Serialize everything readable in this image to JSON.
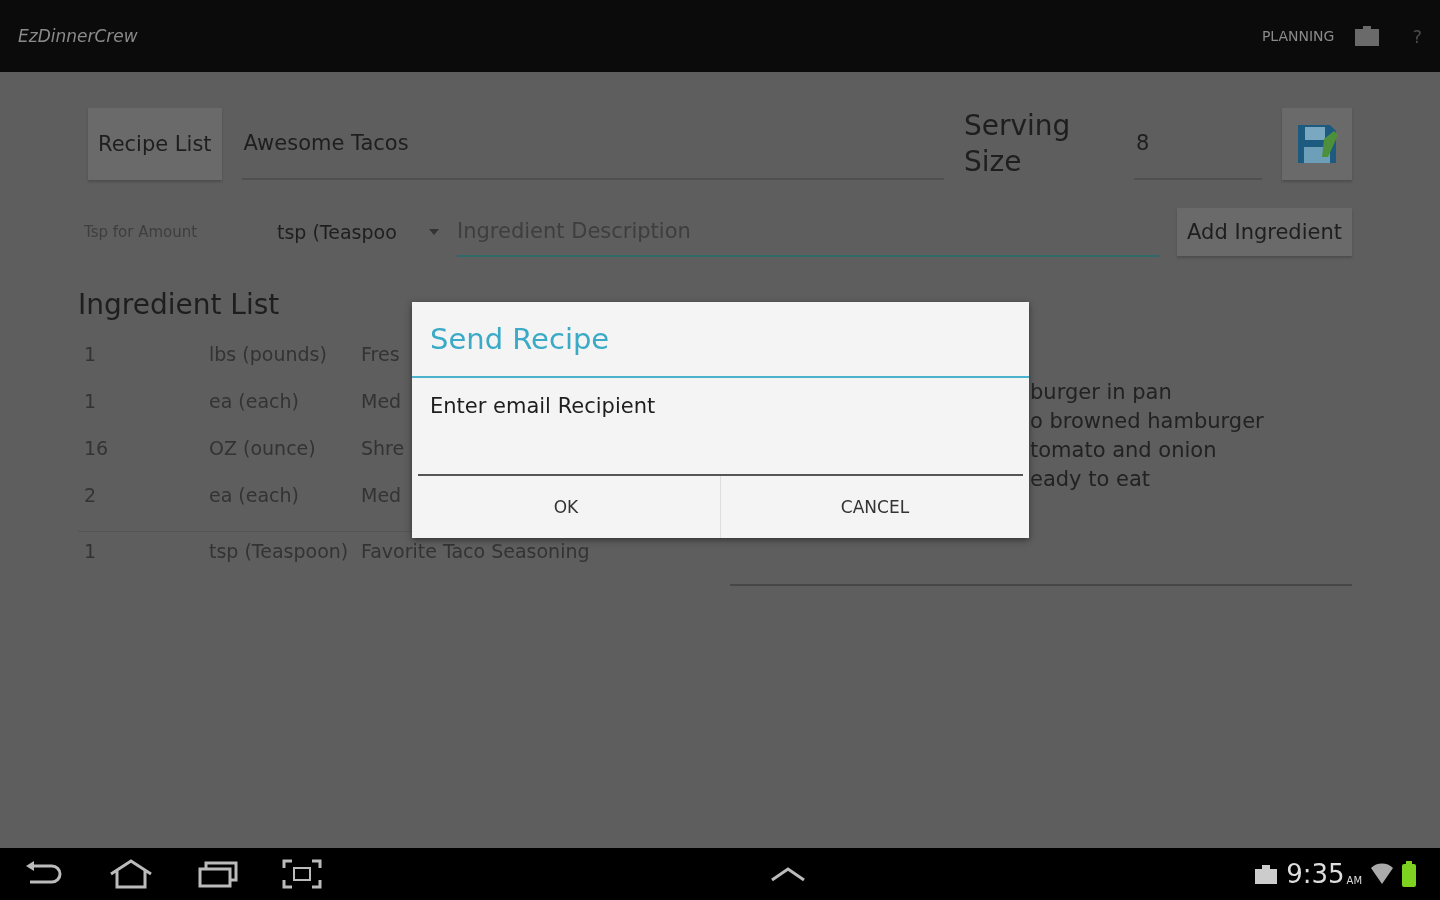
{
  "app_bar": {
    "title": "EzDinnerCrew",
    "action": "PLANNING",
    "help": "?"
  },
  "recipe": {
    "list_button": "Recipe List",
    "name": "Awesome Tacos",
    "serving_label": "Serving Size",
    "serving_size": "8"
  },
  "ingredient_entry": {
    "amount_placeholder": "Tsp for Amount",
    "unit": "tsp (Teaspoo",
    "description_placeholder": "Ingredient Description",
    "add_button": "Add Ingredient"
  },
  "ingredient_list": {
    "title": "Ingredient List",
    "rows": [
      {
        "amount": "1",
        "unit": "lbs (pounds)",
        "description": "Fres"
      },
      {
        "amount": "1",
        "unit": "ea (each)",
        "description": "Med"
      },
      {
        "amount": "16",
        "unit": "OZ (ounce)",
        "description": "Shre"
      },
      {
        "amount": "2",
        "unit": "ea (each)",
        "description": "Med"
      },
      {
        "amount": "1",
        "unit": "tsp (Teaspoon)",
        "description": "Favorite Taco Seasoning"
      }
    ]
  },
  "directions": {
    "lines": [
      "burger in pan",
      "o browned hamburger",
      "tomato and onion",
      "eady to eat"
    ]
  },
  "dialog": {
    "title": "Send Recipe",
    "message": "Enter email Recipient",
    "buttons": [
      "OK",
      "CANCEL"
    ]
  },
  "status_bar": {
    "time": "9:35",
    "ampm": "AM"
  }
}
